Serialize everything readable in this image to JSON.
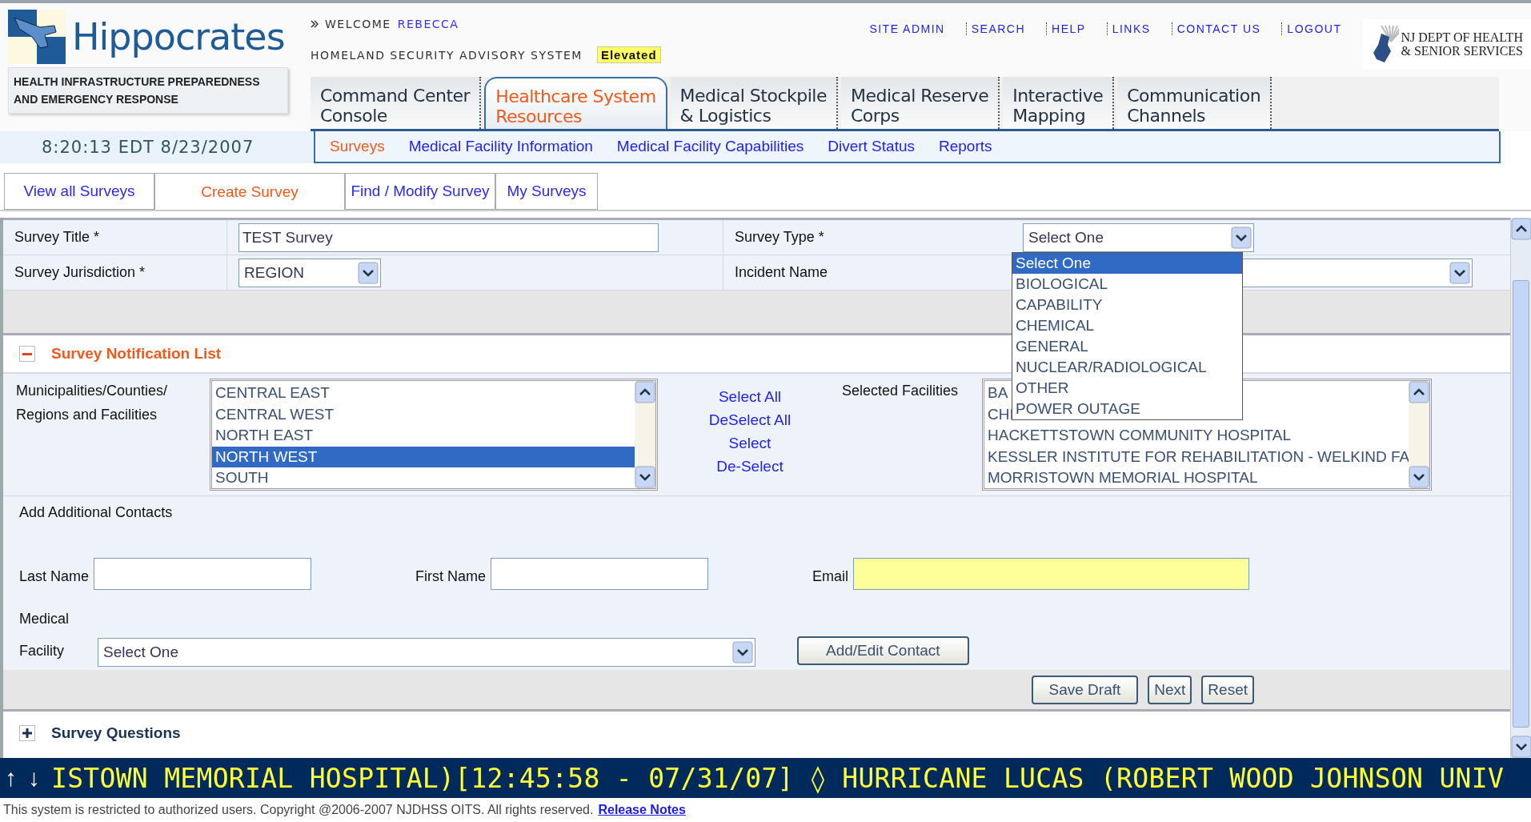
{
  "header": {
    "logo_title": "Hippocrates",
    "logo_subtitle_lines": [
      "HEALTH  INFRASTRUCTURE PREPAREDNESS",
      "AND EMERGENCY RESPONSE"
    ],
    "welcome_label": "WELCOME",
    "user_name": "REBECCA",
    "advisory_label": "HOMELAND SECURITY ADVISORY SYSTEM",
    "advisory_level": "Elevated",
    "top_links": [
      "SITE ADMIN",
      "SEARCH",
      "HELP",
      "LINKS",
      "CONTACT US",
      "LOGOUT"
    ],
    "agency_lines": [
      "NJ DEPT OF HEALTH",
      "& SENIOR SERVICES"
    ]
  },
  "main_tabs": [
    {
      "lines": [
        "Command Center",
        "Console"
      ],
      "selected": false
    },
    {
      "lines": [
        "Healthcare System",
        "Resources"
      ],
      "selected": true
    },
    {
      "lines": [
        "Medical  Stockpile",
        "& Logistics"
      ],
      "selected": false
    },
    {
      "lines": [
        "Medical Reserve",
        "Corps"
      ],
      "selected": false
    },
    {
      "lines": [
        "Interactive",
        "Mapping"
      ],
      "selected": false
    },
    {
      "lines": [
        "Communication",
        "Channels"
      ],
      "selected": false
    }
  ],
  "clock": "8:20:13 EDT 8/23/2007",
  "sub_nav": [
    {
      "label": "Surveys",
      "selected": true
    },
    {
      "label": "Medical Facility Information",
      "selected": false
    },
    {
      "label": "Medical Facility Capabilities",
      "selected": false
    },
    {
      "label": "Divert Status",
      "selected": false
    },
    {
      "label": "Reports",
      "selected": false
    }
  ],
  "survey_tabs": [
    {
      "label": "View all Surveys",
      "selected": false
    },
    {
      "label": "Create Survey",
      "selected": true
    },
    {
      "label": "Find / Modify Survey",
      "selected": false
    },
    {
      "label": "My Surveys",
      "selected": false
    }
  ],
  "form": {
    "survey_title": {
      "label": "Survey Title *",
      "value": "TEST Survey"
    },
    "survey_jurisdiction": {
      "label": "Survey Jurisdiction *",
      "value": "REGION"
    },
    "survey_type": {
      "label": "Survey Type *",
      "value": "Select One",
      "expanded": true,
      "options": [
        {
          "label": "Select One",
          "selected": true
        },
        {
          "label": "BIOLOGICAL",
          "selected": false
        },
        {
          "label": "CAPABILITY",
          "selected": false
        },
        {
          "label": "CHEMICAL",
          "selected": false
        },
        {
          "label": "GENERAL",
          "selected": false
        },
        {
          "label": "NUCLEAR/RADIOLOGICAL",
          "selected": false
        },
        {
          "label": "OTHER",
          "selected": false
        },
        {
          "label": "POWER OUTAGE",
          "selected": false
        }
      ]
    },
    "incident_name": {
      "label": "Incident Name"
    }
  },
  "notification_list": {
    "title": "Survey Notification List",
    "expanded": true,
    "source_label_lines": [
      "Municipalities/Counties/",
      "Regions and Facilities"
    ],
    "source_items": [
      {
        "label": "CENTRAL EAST",
        "selected": false
      },
      {
        "label": "CENTRAL WEST",
        "selected": false
      },
      {
        "label": "NORTH EAST",
        "selected": false
      },
      {
        "label": "NORTH WEST",
        "selected": true
      },
      {
        "label": "SOUTH",
        "selected": false
      }
    ],
    "actions": [
      "Select All",
      "DeSelect All",
      "Select",
      "De-Select"
    ],
    "selected_label": "Selected Facilities",
    "selected_items": [
      "BA",
      "CHI",
      "HACKETTSTOWN COMMUNITY HOSPITAL",
      "KESSLER INSTITUTE FOR REHABILITATION - WELKIND FA",
      "MORRISTOWN MEMORIAL HOSPITAL"
    ]
  },
  "contacts": {
    "title": "Add Additional Contacts",
    "last_name_label": "Last Name",
    "first_name_label": "First Name",
    "email_label": "Email",
    "facility_label_lines": [
      "Medical",
      "Facility"
    ],
    "facility_value": "Select One",
    "add_button": "Add/Edit Contact"
  },
  "buttons": [
    "Save Draft",
    "Next",
    "Reset"
  ],
  "survey_questions": {
    "title": "Survey Questions",
    "expanded": false
  },
  "ticker": {
    "arrows": [
      "↑",
      "↓"
    ],
    "text": "ISTOWN MEMORIAL HOSPITAL)[12:45:58 - 07/31/07] ◊ HURRICANE LUCAS (ROBERT WOOD JOHNSON UNIV"
  },
  "footer": {
    "notice": "This system is restricted to authorized users. Copyright @2006-2007 NJDHSS OITS. All rights reserved.",
    "link": "Release Notes"
  }
}
